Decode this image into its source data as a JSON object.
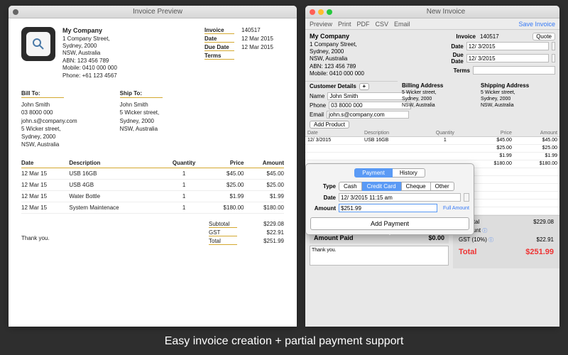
{
  "tagline": "Easy invoice creation + partial payment support",
  "preview": {
    "title": "Invoice Preview",
    "company": {
      "name": "My Company",
      "addr1": "1 Company Street,",
      "addr2": "Sydney, 2000",
      "addr3": "NSW, Australia",
      "abn": "ABN: 123 456 789",
      "mobile": "Mobile: 0410 000 000",
      "phone": "Phone: +61 123 4567"
    },
    "meta": {
      "invoice_label": "Invoice",
      "invoice_no": "140517",
      "date_label": "Date",
      "date": "12 Mar 2015",
      "due_label": "Due Date",
      "due": "12 Mar 2015",
      "terms_label": "Terms"
    },
    "bill_to_label": "Bill To:",
    "ship_to_label": "Ship To:",
    "bill_to": {
      "name": "John Smith",
      "phone": "03 8000 000",
      "email": "john.s@company.com",
      "addr1": "5 Wicker street,",
      "addr2": "Sydney, 2000",
      "addr3": "NSW, Australia"
    },
    "ship_to": {
      "name": "John Smith",
      "addr1": "5 Wicker street,",
      "addr2": "Sydney, 2000",
      "addr3": "NSW, Australia"
    },
    "cols": {
      "date": "Date",
      "desc": "Description",
      "qty": "Quantity",
      "price": "Price",
      "amount": "Amount"
    },
    "rows": [
      {
        "date": "12 Mar 15",
        "desc": "USB 16GB",
        "qty": "1",
        "price": "$45.00",
        "amount": "$45.00"
      },
      {
        "date": "12 Mar 15",
        "desc": "USB 4GB",
        "qty": "1",
        "price": "$25.00",
        "amount": "$25.00"
      },
      {
        "date": "12 Mar 15",
        "desc": "Water Bottle",
        "qty": "1",
        "price": "$1.99",
        "amount": "$1.99"
      },
      {
        "date": "12 Mar 15",
        "desc": "System Maintenace",
        "qty": "1",
        "price": "$180.00",
        "amount": "$180.00"
      }
    ],
    "thank": "Thank you.",
    "subtotal_label": "Subtotal",
    "subtotal": "$229.08",
    "gst_label": "GST",
    "gst": "$22.91",
    "total_label": "Total",
    "total": "$251.99"
  },
  "newinv": {
    "title": "New Invoice",
    "toolbar": {
      "preview": "Preview",
      "print": "Print",
      "pdf": "PDF",
      "csv": "CSV",
      "email": "Email",
      "save": "Save Invoice"
    },
    "company": {
      "name": "My Company",
      "addr1": "1 Company Street,",
      "addr2": "Sydney, 2000",
      "addr3": "NSW, Australia",
      "abn": "ABN: 123 456 789",
      "mobile": "Mobile: 0410 000 000"
    },
    "fields": {
      "invoice_label": "Invoice",
      "invoice_no": "140517",
      "date_label": "Date",
      "date": "12/ 3/2015",
      "due_label": "Due Date",
      "due": "12/ 3/2015",
      "terms_label": "Terms",
      "terms": "",
      "quote": "Quote"
    },
    "cust_header": "Customer Details",
    "cust": {
      "name_label": "Name",
      "name": "John Smith",
      "phone_label": "Phone",
      "phone": "03 8000 000",
      "email_label": "Email",
      "email": "john.s@company.com"
    },
    "billing_h": "Billing Address",
    "shipping_h": "Shipping Address",
    "addr": {
      "l1": "5 Wicker street,",
      "l2": "Sydney, 2000",
      "l3": "NSW, Australia"
    },
    "add_product": "Add Product",
    "pcols": {
      "date": "Date",
      "desc": "Description",
      "qty": "Quantity",
      "price": "Price",
      "amount": "Amount"
    },
    "prows": [
      {
        "date": "12/ 3/2015",
        "desc": "USB 16GB",
        "qty": "1",
        "price": "$45.00",
        "amount": "$45.00"
      },
      {
        "date": "",
        "desc": "",
        "qty": "",
        "price": "$25.00",
        "amount": "$25.00"
      },
      {
        "date": "",
        "desc": "",
        "qty": "",
        "price": "$1.99",
        "amount": "$1.99"
      },
      {
        "date": "",
        "desc": "",
        "qty": "",
        "price": "$180.00",
        "amount": "$180.00"
      }
    ],
    "payment_bar": "Payment",
    "amount_paid_label": "Amount Paid",
    "amount_paid": "$0.00",
    "thank": "Thank you.",
    "summary": {
      "subtotal_l": "Subtotal",
      "subtotal": "$229.08",
      "discount_l": "Discount",
      "discount": "",
      "gst_l": "GST (10%)",
      "gst": "$22.91",
      "total_l": "Total",
      "total": "$251.99"
    }
  },
  "popover": {
    "tabs": {
      "payment": "Payment",
      "history": "History"
    },
    "type_label": "Type",
    "types": {
      "cash": "Cash",
      "credit": "Credit Card",
      "cheque": "Cheque",
      "other": "Other"
    },
    "date_label": "Date",
    "date": "12/ 3/2015 11:15 am",
    "amount_label": "Amount",
    "amount": "$251.99",
    "full": "Full Amount",
    "add_payment": "Add Payment"
  }
}
